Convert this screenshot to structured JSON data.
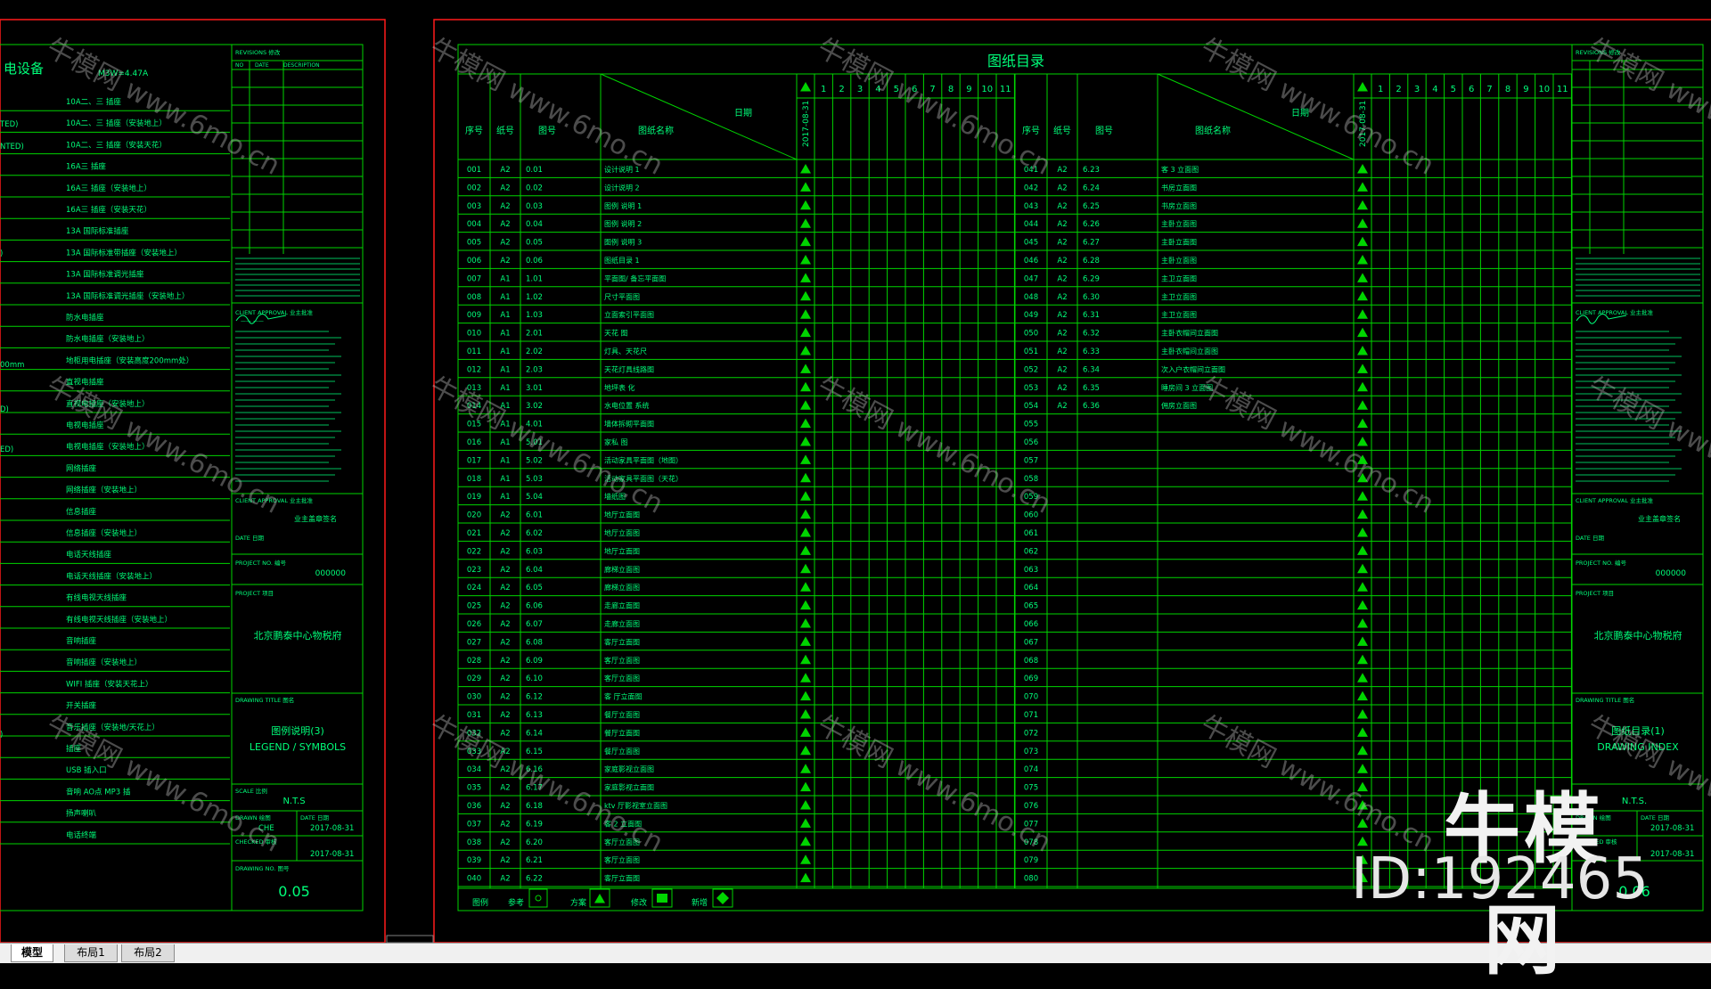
{
  "watermark": "牛模网 www.6mo.cn",
  "brand": {
    "name": "牛模网",
    "id": "ID:192465"
  },
  "tabs": [
    "模型",
    "布局1",
    "布局2"
  ],
  "colors": {
    "line": "#00d400",
    "text": "#00ff7a",
    "frame": "#ff1a1a",
    "background": "#000000"
  },
  "left_sheet": {
    "heading": "电设备",
    "power_note": "M3W=4.47A",
    "prefixes": [
      "TED)",
      "NTED)",
      ")",
      "00mm",
      "D)",
      "ED)",
      ")"
    ],
    "legend_items": [
      "10A二、三 插座",
      "10A二、三 插座（安装地上）",
      "10A二、三 插座（安装天花）",
      "16A三 插座",
      "16A三 插座（安装地上）",
      "16A三 插座（安装天花）",
      "13A 国际标准插座",
      "13A 国际标准带插座（安装地上）",
      "13A 国际标准调光插座",
      "13A 国际标准调光插座（安装地上）",
      "防水电插座",
      "防水电插座（安装地上）",
      "地柜用电插座（安装高度200mm处）",
      "直视电插座",
      "直视电插座（安装地上）",
      "电视电插座",
      "电视电插座（安装地上）",
      "网络插座",
      "网络插座（安装地上）",
      "信息插座",
      "信息插座（安装地上）",
      "电话天线插座",
      "电话天线插座（安装地上）",
      "有线电视天线插座",
      "有线电视天线插座（安装地上）",
      "音响插座",
      "音响插座（安装地上）",
      "WIFI  插座（安装天花上）",
      "开关插座",
      "音乐插座（安装地/天花上）",
      "插座",
      "USB 插入口",
      "音响 AO点 MP3 插",
      "扬声喇叭",
      "电话终端"
    ],
    "title_block": {
      "revisions": "REVISIONS 修改",
      "rev_cols": [
        "NO",
        "DATE",
        "DESCRIPTION"
      ],
      "client_approval": "CLIENT APPROVAL  业主批准",
      "client_sign": "业主盖章签名",
      "date": "DATE 日期",
      "project_no_label": "PROJECT NO. 编号",
      "project_no": "000000",
      "project_label": "PROJECT 项目",
      "project": "北京鹏泰中心物税府",
      "drawing_title_label": "DRAWING TITLE 图名",
      "drawing_title": "图例说明(3)",
      "drawing_title_en": "LEGEND / SYMBOLS",
      "scale_label": "SCALE 比例",
      "scale": "N.T.S",
      "drawn_label": "DRAWN 绘图",
      "drawn": "CHE",
      "date_label": "DATE 日期",
      "date1": "2017-08-31",
      "checked_label": "CHECKED 审核",
      "date2": "2017-08-31",
      "drawing_no_label": "DRAWING NO. 图号",
      "drawing_no": "0.05"
    }
  },
  "index_sheet": {
    "title": "图纸目录",
    "headers": {
      "seq": "序号",
      "size": "纸号",
      "no": "图号",
      "name": "图纸名称",
      "date": "日期",
      "issue_date": "2017-08-31"
    },
    "rev_columns": [
      "1",
      "2",
      "3",
      "4",
      "5",
      "6",
      "7",
      "8",
      "9",
      "10",
      "11"
    ],
    "left_rows": [
      [
        "001",
        "A2",
        "0.01",
        "设计说明 1"
      ],
      [
        "002",
        "A2",
        "0.02",
        "设计说明 2"
      ],
      [
        "003",
        "A2",
        "0.03",
        "图例 说明 1"
      ],
      [
        "004",
        "A2",
        "0.04",
        "图例 说明 2"
      ],
      [
        "005",
        "A2",
        "0.05",
        "图例 说明 3"
      ],
      [
        "006",
        "A2",
        "0.06",
        "图纸目录 1"
      ],
      [
        "007",
        "A1",
        "1.01",
        "平面图/ 备忘平面图"
      ],
      [
        "008",
        "A1",
        "1.02",
        "尺寸平面图"
      ],
      [
        "009",
        "A1",
        "1.03",
        "立面索引平面图"
      ],
      [
        "010",
        "A1",
        "2.01",
        "天花 图"
      ],
      [
        "011",
        "A1",
        "2.02",
        "灯具、天花尺"
      ],
      [
        "012",
        "A1",
        "2.03",
        "天花灯具线路图"
      ],
      [
        "013",
        "A1",
        "3.01",
        "地坪表   化"
      ],
      [
        "014",
        "A1",
        "3.02",
        "水电位置 系统"
      ],
      [
        "015",
        "A1",
        "4.01",
        "墙体拆砌平面图"
      ],
      [
        "016",
        "A1",
        "5.01",
        "家私 图"
      ],
      [
        "017",
        "A1",
        "5.02",
        "活动家具平面图（地图）"
      ],
      [
        "018",
        "A1",
        "5.03",
        "活动家具平面图（天花）"
      ],
      [
        "019",
        "A1",
        "5.04",
        "墙纸图"
      ],
      [
        "020",
        "A2",
        "6.01",
        "地厅立面图"
      ],
      [
        "021",
        "A2",
        "6.02",
        "地厅立面图"
      ],
      [
        "022",
        "A2",
        "6.03",
        "地厅立面图"
      ],
      [
        "023",
        "A2",
        "6.04",
        "廊梯立面图"
      ],
      [
        "024",
        "A2",
        "6.05",
        "廊梯立面图"
      ],
      [
        "025",
        "A2",
        "6.06",
        "走廊立面图"
      ],
      [
        "026",
        "A2",
        "6.07",
        "走廊立面图"
      ],
      [
        "027",
        "A2",
        "6.08",
        "客厅立面图"
      ],
      [
        "028",
        "A2",
        "6.09",
        "客厅立面图"
      ],
      [
        "029",
        "A2",
        "6.10",
        "客厅立面图"
      ],
      [
        "030",
        "A2",
        "6.12",
        "客 厅立面图"
      ],
      [
        "031",
        "A2",
        "6.13",
        "餐厅立面图"
      ],
      [
        "032",
        "A2",
        "6.14",
        "餐厅立面图"
      ],
      [
        "033",
        "A2",
        "6.15",
        "餐厅立面图"
      ],
      [
        "034",
        "A2",
        "6.16",
        "家庭影视立面图"
      ],
      [
        "035",
        "A2",
        "6.17",
        "家庭影视立面图"
      ],
      [
        "036",
        "A2",
        "6.18",
        "ktv 厅影视室立面图"
      ],
      [
        "037",
        "A2",
        "6.19",
        "客 2 立面图"
      ],
      [
        "038",
        "A2",
        "6.20",
        "客厅立面图"
      ],
      [
        "039",
        "A2",
        "6.21",
        "客厅立面图"
      ],
      [
        "040",
        "A2",
        "6.22",
        "客厅立面图"
      ]
    ],
    "right_rows": [
      [
        "041",
        "A2",
        "6.23",
        "客 3 立面图"
      ],
      [
        "042",
        "A2",
        "6.24",
        "书房立面图"
      ],
      [
        "043",
        "A2",
        "6.25",
        "书房立面图"
      ],
      [
        "044",
        "A2",
        "6.26",
        "主卧立面图"
      ],
      [
        "045",
        "A2",
        "6.27",
        "主卧立面图"
      ],
      [
        "046",
        "A2",
        "6.28",
        "主卧立面图"
      ],
      [
        "047",
        "A2",
        "6.29",
        "主卫立面图"
      ],
      [
        "048",
        "A2",
        "6.30",
        "主卫立面图"
      ],
      [
        "049",
        "A2",
        "6.31",
        "主卫立面图"
      ],
      [
        "050",
        "A2",
        "6.32",
        "主卧衣帽间立面图"
      ],
      [
        "051",
        "A2",
        "6.33",
        "主卧衣帽间立面图"
      ],
      [
        "052",
        "A2",
        "6.34",
        "次入户衣帽间立面图"
      ],
      [
        "053",
        "A2",
        "6.35",
        "睡房间 3 立面图"
      ],
      [
        "054",
        "A2",
        "6.36",
        "佣房立面图"
      ],
      [
        "055",
        "",
        "",
        ""
      ],
      [
        "056",
        "",
        "",
        ""
      ],
      [
        "057",
        "",
        "",
        ""
      ],
      [
        "058",
        "",
        "",
        ""
      ],
      [
        "059",
        "",
        "",
        ""
      ],
      [
        "060",
        "",
        "",
        ""
      ],
      [
        "061",
        "",
        "",
        ""
      ],
      [
        "062",
        "",
        "",
        ""
      ],
      [
        "063",
        "",
        "",
        ""
      ],
      [
        "064",
        "",
        "",
        ""
      ],
      [
        "065",
        "",
        "",
        ""
      ],
      [
        "066",
        "",
        "",
        ""
      ],
      [
        "067",
        "",
        "",
        ""
      ],
      [
        "068",
        "",
        "",
        ""
      ],
      [
        "069",
        "",
        "",
        ""
      ],
      [
        "070",
        "",
        "",
        ""
      ],
      [
        "071",
        "",
        "",
        ""
      ],
      [
        "072",
        "",
        "",
        ""
      ],
      [
        "073",
        "",
        "",
        ""
      ],
      [
        "074",
        "",
        "",
        ""
      ],
      [
        "075",
        "",
        "",
        ""
      ],
      [
        "076",
        "",
        "",
        ""
      ],
      [
        "077",
        "",
        "",
        ""
      ],
      [
        "078",
        "",
        "",
        ""
      ],
      [
        "079",
        "",
        "",
        ""
      ],
      [
        "080",
        "",
        "",
        ""
      ]
    ],
    "legend": {
      "label": "图例",
      "ref": "参考",
      "plan": "方案",
      "revise": "修改",
      "new": "新增"
    }
  },
  "right_sheet": {
    "title_block": {
      "revisions": "REVISIONS 修改",
      "client_approval": "CLIENT APPROVAL  业主批准",
      "client_sign": "业主盖章签名",
      "date": "DATE 日期",
      "project_no_label": "PROJECT NO. 编号",
      "project_no": "000000",
      "project_label": "PROJECT 项目",
      "project": "北京鹏泰中心物税府",
      "drawing_title_label": "DRAWING TITLE 图名",
      "drawing_title": "图纸目录(1)",
      "drawing_title_en": "DRAWING INDEX",
      "scale": "N.T.S.",
      "date1": "2017-08-31",
      "date2": "2017-08-31",
      "drawn_label": "DRAWN 绘图",
      "checked_label": "CHECKED 审核",
      "date_label": "DATE 日期",
      "drawing_no": "0.06"
    }
  }
}
